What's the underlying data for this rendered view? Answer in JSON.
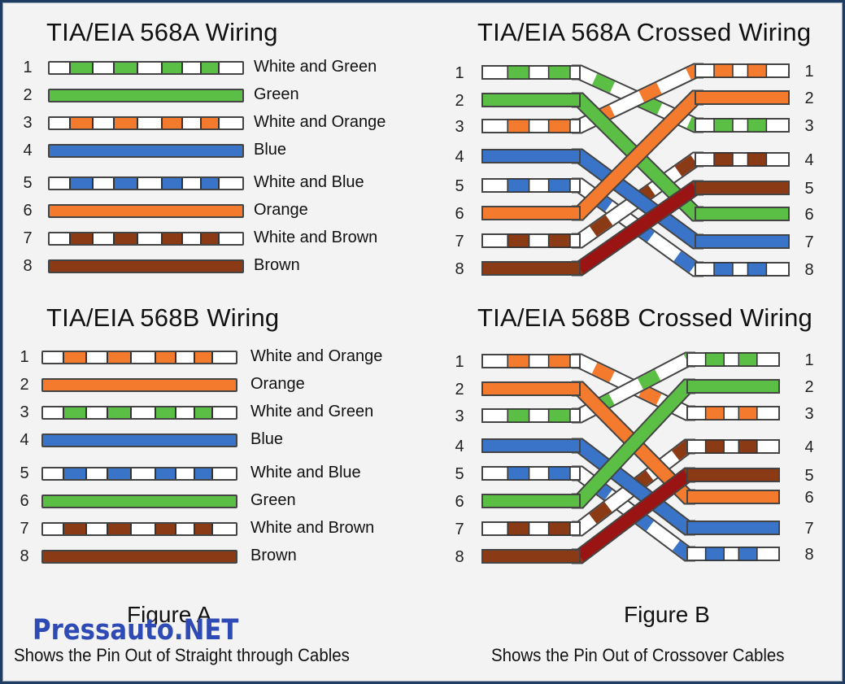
{
  "colors": {
    "green": "#5cbf45",
    "orange": "#f47a2e",
    "blue": "#3a74c9",
    "brown": "#8a3b16",
    "white": "#ffffff",
    "dark_red": "#9a1414",
    "watermark": "#2e4bb5"
  },
  "panels": {
    "a568": {
      "title": "TIA/EIA 568A Wiring",
      "wires": [
        {
          "pin": "1",
          "label": "White and Green",
          "color": "green",
          "striped": true
        },
        {
          "pin": "2",
          "label": "Green",
          "color": "green",
          "striped": false
        },
        {
          "pin": "3",
          "label": "White and Orange",
          "color": "orange",
          "striped": true
        },
        {
          "pin": "4",
          "label": "Blue",
          "color": "blue",
          "striped": false
        },
        {
          "pin": "5",
          "label": "White and Blue",
          "color": "blue",
          "striped": true
        },
        {
          "pin": "6",
          "label": "Orange",
          "color": "orange",
          "striped": false
        },
        {
          "pin": "7",
          "label": "White and Brown",
          "color": "brown",
          "striped": true
        },
        {
          "pin": "8",
          "label": "Brown",
          "color": "brown",
          "striped": false
        }
      ]
    },
    "b568": {
      "title": "TIA/EIA 568B Wiring",
      "wires": [
        {
          "pin": "1",
          "label": "White and Orange",
          "color": "orange",
          "striped": true
        },
        {
          "pin": "2",
          "label": "Orange",
          "color": "orange",
          "striped": false
        },
        {
          "pin": "3",
          "label": "White and Green",
          "color": "green",
          "striped": true
        },
        {
          "pin": "4",
          "label": "Blue",
          "color": "blue",
          "striped": false
        },
        {
          "pin": "5",
          "label": "White and Blue",
          "color": "blue",
          "striped": true
        },
        {
          "pin": "6",
          "label": "Green",
          "color": "green",
          "striped": false
        },
        {
          "pin": "7",
          "label": "White and Brown",
          "color": "brown",
          "striped": true
        },
        {
          "pin": "8",
          "label": "Brown",
          "color": "brown",
          "striped": false
        }
      ]
    },
    "a568_crossed": {
      "title": "TIA/EIA 568A Crossed Wiring",
      "left_pins": [
        "1",
        "2",
        "3",
        "4",
        "5",
        "6",
        "7",
        "8"
      ],
      "right_pins": [
        "1",
        "2",
        "3",
        "4",
        "5",
        "6",
        "7",
        "8"
      ],
      "left": [
        {
          "color": "green",
          "striped": true
        },
        {
          "color": "green",
          "striped": false
        },
        {
          "color": "orange",
          "striped": true
        },
        {
          "color": "blue",
          "striped": false
        },
        {
          "color": "blue",
          "striped": true
        },
        {
          "color": "orange",
          "striped": false
        },
        {
          "color": "brown",
          "striped": true
        },
        {
          "color": "brown",
          "striped": false
        }
      ],
      "right": [
        {
          "color": "orange",
          "striped": true
        },
        {
          "color": "orange",
          "striped": false
        },
        {
          "color": "green",
          "striped": true
        },
        {
          "color": "brown",
          "striped": true
        },
        {
          "color": "brown",
          "striped": false
        },
        {
          "color": "green",
          "striped": false
        },
        {
          "color": "blue",
          "striped": false
        },
        {
          "color": "blue",
          "striped": true
        }
      ],
      "connections": [
        [
          1,
          3
        ],
        [
          2,
          6
        ],
        [
          3,
          1
        ],
        [
          4,
          7
        ],
        [
          5,
          8
        ],
        [
          6,
          2
        ],
        [
          7,
          4
        ],
        [
          8,
          5
        ]
      ]
    },
    "b568_crossed": {
      "title": "TIA/EIA 568B Crossed Wiring",
      "left_pins": [
        "1",
        "2",
        "3",
        "4",
        "5",
        "6",
        "7",
        "8"
      ],
      "right_pins": [
        "1",
        "2",
        "3",
        "4",
        "5",
        "6",
        "7",
        "8"
      ],
      "left": [
        {
          "color": "orange",
          "striped": true
        },
        {
          "color": "orange",
          "striped": false
        },
        {
          "color": "green",
          "striped": true
        },
        {
          "color": "blue",
          "striped": false
        },
        {
          "color": "blue",
          "striped": true
        },
        {
          "color": "green",
          "striped": false
        },
        {
          "color": "brown",
          "striped": true
        },
        {
          "color": "brown",
          "striped": false
        }
      ],
      "right": [
        {
          "color": "green",
          "striped": true
        },
        {
          "color": "green",
          "striped": false
        },
        {
          "color": "orange",
          "striped": true
        },
        {
          "color": "brown",
          "striped": true
        },
        {
          "color": "brown",
          "striped": false
        },
        {
          "color": "orange",
          "striped": false
        },
        {
          "color": "blue",
          "striped": false
        },
        {
          "color": "blue",
          "striped": true
        }
      ],
      "connections": [
        [
          1,
          3
        ],
        [
          2,
          6
        ],
        [
          3,
          1
        ],
        [
          4,
          7
        ],
        [
          5,
          8
        ],
        [
          6,
          2
        ],
        [
          7,
          4
        ],
        [
          8,
          5
        ]
      ]
    }
  },
  "figure_a": {
    "label": "Figure A",
    "caption": "Shows the Pin Out of Straight through Cables"
  },
  "figure_b": {
    "label": "Figure B",
    "caption": "Shows the Pin Out of Crossover Cables"
  },
  "watermark": "Pressauto.NET"
}
